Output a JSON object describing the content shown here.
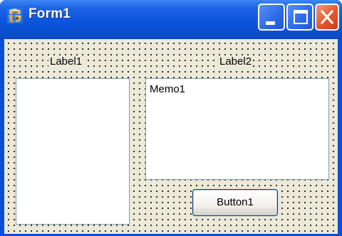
{
  "window": {
    "title": "Form1",
    "icon": "delphi-app-icon",
    "caption_buttons": [
      "minimize",
      "maximize",
      "close"
    ]
  },
  "form": {
    "label1": "Label1",
    "label2": "Label2",
    "memo_text": "Memo1",
    "button_label": "Button1"
  },
  "colors": {
    "title_bar": "#0a4fd6",
    "client_bg": "#ece9d8",
    "close_button": "#e4572e",
    "control_border": "#7f9db9"
  }
}
